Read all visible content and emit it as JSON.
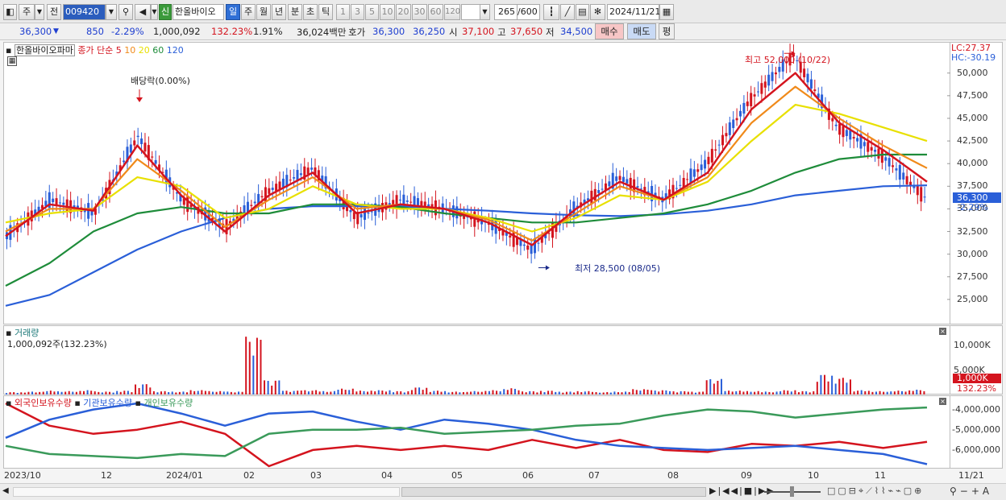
{
  "toolbar": {
    "market_type": "주",
    "scope": "전",
    "stock_code": "009420",
    "stock_name": "한올바이오",
    "new_badge": "신",
    "periods": [
      "일",
      "주",
      "월",
      "년",
      "분",
      "초",
      "틱"
    ],
    "active_period": "일",
    "intervals": [
      "1",
      "3",
      "5",
      "10",
      "20",
      "30",
      "60",
      "120"
    ],
    "count": "265",
    "max_count": "/600",
    "date": "2024/11/21"
  },
  "quote": {
    "price": "36,300",
    "change": "850",
    "change_rate": "-2.29%",
    "volume": "1,000,092",
    "volume_ratio": "132.23%",
    "turnover_rate": "1.91%",
    "amount": "36,024백만",
    "ask_label": "호가",
    "ask1": "36,300",
    "ask2": "36,250",
    "open_label": "시",
    "open": "37,100",
    "high_label": "고",
    "high": "37,650",
    "low_label": "저",
    "low": "34,500",
    "buy_label": "매수",
    "sell_label": "매도",
    "flat_label": "평"
  },
  "price_pane": {
    "stock_label": "한올바이오파마",
    "ma_label": "종가 단순",
    "ma_periods": [
      "5",
      "10",
      "20",
      "60",
      "120"
    ],
    "ma_colors": [
      "#d4141e",
      "#f08a1a",
      "#e8e000",
      "#1e8c3a",
      "#2a5fd8"
    ],
    "lc": "LC:27.37",
    "hc": "HC:-30.19",
    "high_note": "최고 52,000 (10/22)",
    "low_note": "최저 28,500 (08/05)",
    "dividend_note": "배당락(0.00%)",
    "current_price_tag": "36,300",
    "current_change_tag": "-2.29%"
  },
  "volume_pane": {
    "title": "거래량",
    "sub": "1,000,092주(132.23%)",
    "tag": "1,000K",
    "tag_ratio": "132.23%"
  },
  "holding_pane": {
    "series": [
      {
        "name": "외국인보유수량",
        "color": "#d4141e"
      },
      {
        "name": "기관보유수량",
        "color": "#2a5fd8"
      },
      {
        "name": "개인보유수량",
        "color": "#3a9a5a"
      }
    ]
  },
  "date_axis": [
    "2023/10",
    "12",
    "2024/01",
    "02",
    "03",
    "04",
    "05",
    "06",
    "07",
    "08",
    "09",
    "10",
    "11",
    "11/21"
  ],
  "chart_data": [
    {
      "type": "line",
      "title": "한올바이오파마",
      "xlabel": "",
      "ylabel": "",
      "ylim": [
        22500,
        53000
      ],
      "y_ticks": [
        "50,000",
        "47,500",
        "45,000",
        "42,500",
        "40,000",
        "37,500",
        "35,000",
        "32,500",
        "30,000",
        "27,500",
        "25,000"
      ],
      "x": [
        "2023/10",
        "12",
        "2024/01",
        "02",
        "03",
        "04",
        "05",
        "06",
        "07",
        "08",
        "09",
        "10",
        "11"
      ],
      "series": [
        {
          "name": "종가",
          "values": [
            32000,
            36000,
            34500,
            43000,
            36000,
            33000,
            37000,
            39500,
            34000,
            36000,
            35000,
            33500,
            30500,
            35000,
            38500,
            36000,
            40000,
            47000,
            52000,
            44000,
            41000,
            36300
          ]
        },
        {
          "name": "5",
          "values": [
            32000,
            35500,
            34800,
            42000,
            36500,
            32500,
            36500,
            39000,
            34500,
            35500,
            35000,
            33500,
            31000,
            35000,
            38000,
            36000,
            39000,
            46000,
            50000,
            44500,
            41500,
            38000
          ]
        },
        {
          "name": "10",
          "values": [
            32500,
            35000,
            35000,
            40500,
            37000,
            33000,
            36000,
            38500,
            35000,
            35500,
            35000,
            33800,
            31500,
            34500,
            37500,
            36000,
            38500,
            44500,
            48500,
            45000,
            42000,
            39500
          ]
        },
        {
          "name": "20",
          "values": [
            33500,
            34500,
            35000,
            38500,
            37500,
            34000,
            35000,
            37500,
            35500,
            35000,
            35000,
            34000,
            32500,
            34000,
            36500,
            36000,
            38000,
            42500,
            46500,
            45500,
            44000,
            42500
          ]
        },
        {
          "name": "60",
          "values": [
            26500,
            29000,
            32500,
            34500,
            35200,
            34500,
            34500,
            35500,
            35500,
            35200,
            34500,
            34000,
            33500,
            33500,
            34000,
            34500,
            35500,
            37000,
            39000,
            40500,
            41000,
            41000
          ]
        },
        {
          "name": "120",
          "values": [
            24300,
            25500,
            28000,
            30500,
            32500,
            34000,
            35000,
            35300,
            35300,
            35300,
            35000,
            34800,
            34500,
            34300,
            34200,
            34400,
            34800,
            35500,
            36500,
            37000,
            37500,
            37600
          ]
        }
      ],
      "annotations": [
        {
          "text": "최고 52,000 (10/22)",
          "y": 52000
        },
        {
          "text": "최저 28,500 (08/05)",
          "y": 28500
        },
        {
          "text": "배당락(0.00%)",
          "y": 47000
        }
      ]
    },
    {
      "type": "bar",
      "title": "거래량",
      "y_ticks": [
        "10,000K",
        "5,000K"
      ],
      "ylim": [
        0,
        13500
      ],
      "values_k": [
        500,
        600,
        800,
        700,
        900,
        600,
        800,
        2200,
        700,
        600,
        900,
        700,
        600,
        12000,
        3000,
        800,
        900,
        700,
        1200,
        800,
        900,
        700,
        1500,
        800,
        600,
        700,
        900,
        1300,
        700,
        800,
        600,
        700,
        500,
        600,
        1100,
        900,
        700,
        600,
        3200,
        800,
        700,
        600,
        900,
        700,
        4200,
        3500,
        900,
        700,
        800,
        1000
      ]
    },
    {
      "type": "line",
      "title": "외국인보유수량 · 기관보유수량 · 개인보유수량",
      "y_ticks": [
        "-4,000,000",
        "-5,000,000",
        "-6,000,000"
      ],
      "ylim": [
        -6800000,
        -3500000
      ],
      "series": [
        {
          "name": "외국인보유수량",
          "values": [
            -3700000,
            -4800000,
            -5200000,
            -5000000,
            -4600000,
            -5200000,
            -6800000,
            -6000000,
            -5800000,
            -6000000,
            -5800000,
            -6000000,
            -5500000,
            -5900000,
            -5500000,
            -6000000,
            -6100000,
            -5700000,
            -5800000,
            -5600000,
            -5900000,
            -5600000
          ]
        },
        {
          "name": "기관보유수량",
          "values": [
            -5400000,
            -4500000,
            -4000000,
            -3700000,
            -4200000,
            -4800000,
            -4200000,
            -4100000,
            -4600000,
            -5000000,
            -4500000,
            -4700000,
            -5000000,
            -5500000,
            -5800000,
            -5900000,
            -6000000,
            -5900000,
            -5800000,
            -6000000,
            -6200000,
            -6700000
          ]
        },
        {
          "name": "개인보유수량",
          "values": [
            -5800000,
            -6200000,
            -6300000,
            -6400000,
            -6200000,
            -6300000,
            -5200000,
            -5000000,
            -5000000,
            -4900000,
            -5200000,
            -5100000,
            -5000000,
            -4800000,
            -4700000,
            -4300000,
            -4000000,
            -4100000,
            -4400000,
            -4200000,
            -4000000,
            -3900000
          ]
        }
      ]
    }
  ]
}
